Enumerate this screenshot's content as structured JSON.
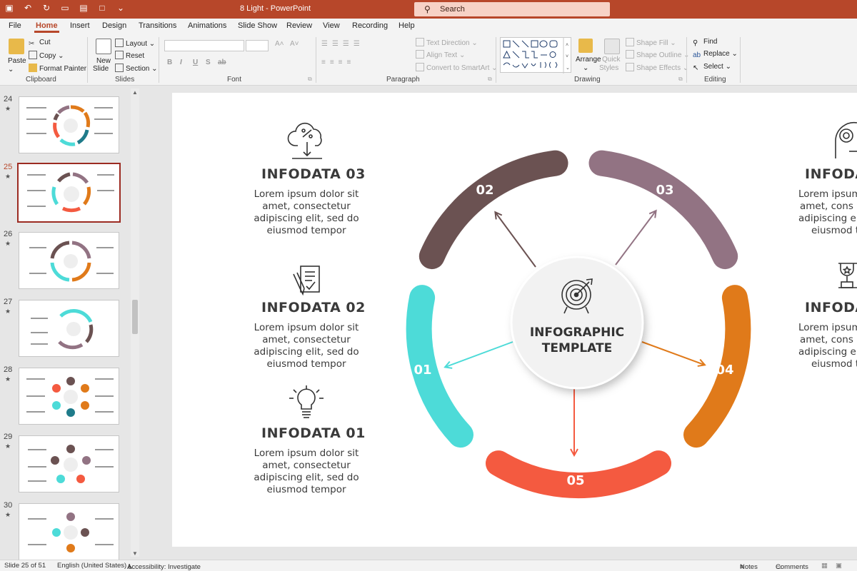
{
  "app": {
    "doc_title": "8 Light  -  PowerPoint",
    "search_placeholder": "Search"
  },
  "tabs": [
    "File",
    "Home",
    "Insert",
    "Design",
    "Transitions",
    "Animations",
    "Slide Show",
    "Review",
    "View",
    "Recording",
    "Help"
  ],
  "ribbon": {
    "clipboard": {
      "paste": "Paste",
      "cut": "Cut",
      "copy": "Copy",
      "format_painter": "Format Painter",
      "label": "Clipboard"
    },
    "slides": {
      "new_slide_1": "New",
      "new_slide_2": "Slide",
      "layout": "Layout",
      "reset": "Reset",
      "section": "Section",
      "label": "Slides"
    },
    "font": {
      "label": "Font",
      "bold": "B",
      "italic": "I",
      "underline": "U",
      "strike": "S",
      "shadow": "ab"
    },
    "paragraph": {
      "text_direction": "Text Direction",
      "align_text": "Align Text",
      "convert_smartart": "Convert to SmartArt",
      "label": "Paragraph"
    },
    "drawing": {
      "arrange": "Arrange",
      "quick_styles_1": "Quick",
      "quick_styles_2": "Styles",
      "shape_fill": "Shape Fill",
      "shape_outline": "Shape Outline",
      "shape_effects": "Shape Effects",
      "label": "Drawing"
    },
    "editing": {
      "find": "Find",
      "replace": "Replace",
      "select": "Select",
      "label": "Editing"
    }
  },
  "thumbnails": [
    {
      "num": "24",
      "star": "★"
    },
    {
      "num": "25",
      "star": "★"
    },
    {
      "num": "26",
      "star": "★"
    },
    {
      "num": "27",
      "star": "★"
    },
    {
      "num": "28",
      "star": "★"
    },
    {
      "num": "29",
      "star": "★"
    },
    {
      "num": "30",
      "star": "★"
    }
  ],
  "slide": {
    "center_title_1": "INFOGRAPHIC",
    "center_title_2": "TEMPLATE",
    "segments": [
      {
        "label": "01",
        "color": "#4ddbd8"
      },
      {
        "label": "02",
        "color": "#6b5252"
      },
      {
        "label": "03",
        "color": "#927383"
      },
      {
        "label": "04",
        "color": "#e07a1a"
      },
      {
        "label": "05",
        "color": "#f45a40"
      }
    ],
    "info": [
      {
        "title": "INFODATA  03",
        "body": [
          "Lorem ipsum dolor sit",
          "amet, consectetur",
          "adipiscing elit, sed do",
          "eiusmod tempor"
        ]
      },
      {
        "title": "INFODATA  02",
        "body": [
          "Lorem ipsum dolor sit",
          "amet, consectetur",
          "adipiscing elit, sed do",
          "eiusmod tempor"
        ]
      },
      {
        "title": "INFODATA  01",
        "body": [
          "Lorem ipsum dolor sit",
          "amet, consectetur",
          "adipiscing elit, sed do",
          "eiusmod tempor"
        ]
      }
    ],
    "right_info": [
      {
        "title": "INFODA",
        "body": [
          "Lorem ipsum",
          "amet, cons",
          "adipiscing el",
          "eiusmod t"
        ]
      },
      {
        "title": "INFODA",
        "body": [
          "Lorem ipsum",
          "amet, cons",
          "adipiscing el",
          "eiusmod t"
        ]
      }
    ]
  },
  "status": {
    "slide_counter": "Slide 25 of 51",
    "language": "English (United States)",
    "accessibility": "Accessibility: Investigate",
    "notes": "Notes",
    "comments": "Comments"
  }
}
